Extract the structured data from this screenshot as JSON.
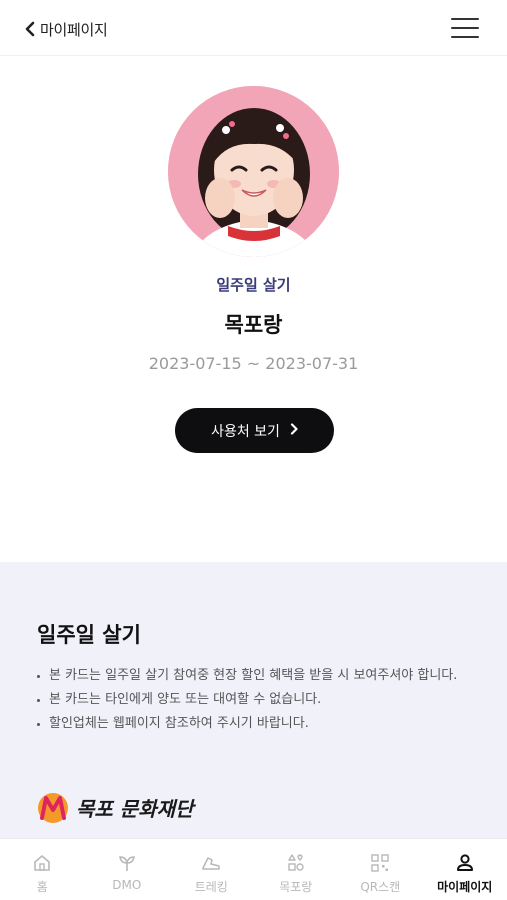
{
  "header": {
    "title": "마이페이지",
    "back_icon": "chevron-left-icon",
    "menu_icon": "hamburger-menu-icon"
  },
  "profile": {
    "program": "일주일 살기",
    "card_name": "목포랑",
    "period": "2023-07-15 ~ 2023-07-31",
    "button_label": "사용처 보기",
    "button_icon": "chevron-right-icon"
  },
  "info": {
    "title": "일주일 살기",
    "notes": [
      "본 카드는 일주일 살기 참여중 현장 할인 혜택을 받을 시 보여주셔야 합니다.",
      "본 카드는 타인에게 양도 또는 대여할 수 없습니다.",
      "할인업체는 웹페이지 참조하여 주시기 바랍니다."
    ],
    "logo_text": "목포 문화재단"
  },
  "tabbar": {
    "items": [
      {
        "label": "홈",
        "icon": "home-icon",
        "active": false
      },
      {
        "label": "DMO",
        "icon": "sprout-icon",
        "active": false
      },
      {
        "label": "트레킹",
        "icon": "hiking-shoe-icon",
        "active": false
      },
      {
        "label": "목포랑",
        "icon": "grid-heart-icon",
        "active": false
      },
      {
        "label": "QR스캔",
        "icon": "qr-scan-icon",
        "active": false
      },
      {
        "label": "마이페이지",
        "icon": "person-icon",
        "active": true
      }
    ]
  },
  "colors": {
    "accent_text": "#3b3b7a",
    "button_bg": "#0e0e10",
    "info_bg": "#f1f1fa",
    "inactive_tab": "#b8b8b8",
    "avatar_bg": "#f3a5b8"
  }
}
